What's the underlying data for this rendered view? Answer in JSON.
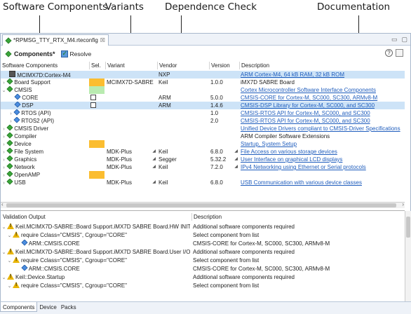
{
  "callouts": {
    "software_components": "Software Components",
    "variants": "Variants",
    "dependence_check": "Dependence Check",
    "documentation": "Documentation"
  },
  "editor": {
    "tab_title": "*RPMSG_TTY_RTX_M4.rteconfig",
    "tab_close": "☒",
    "toolbar_title": "Components*",
    "resolve_label": "Resolve",
    "help_label": "?"
  },
  "components": {
    "headers": {
      "name": "Software Components",
      "sel": "Sel.",
      "variant": "Variant",
      "vendor": "Vendor",
      "version": "Version",
      "description": "Description"
    },
    "rows": [
      {
        "name": "MCIMX7D:Cortex-M4",
        "sel": "",
        "variant": "",
        "vendor": "NXP",
        "version": "",
        "description": "ARM Cortex-M4, 64 kB RAM, 32 kB ROM"
      },
      {
        "name": "Board Support",
        "sel": "",
        "variant": "MCIMX7D-SABRE",
        "vendor": "Keil",
        "version": "1.0.0",
        "description": "iMX7D SABRE Board"
      },
      {
        "name": "CMSIS",
        "sel": "",
        "variant": "",
        "vendor": "",
        "version": "",
        "description": "Cortex Microcontroller Software Interface Components"
      },
      {
        "name": "CORE",
        "sel": "",
        "variant": "",
        "vendor": "ARM",
        "version": "5.0.0",
        "description": "CMSIS-CORE for Cortex-M, SC000, SC300, ARMv8-M"
      },
      {
        "name": "DSP",
        "sel": "",
        "variant": "",
        "vendor": "ARM",
        "version": "1.4.6",
        "description": "CMSIS-DSP Library for Cortex-M, SC000, and SC300"
      },
      {
        "name": "RTOS (API)",
        "sel": "",
        "variant": "",
        "vendor": "",
        "version": "1.0",
        "description": "CMSIS-RTOS API for Cortex-M, SC000, and SC300"
      },
      {
        "name": "RTOS2 (API)",
        "sel": "",
        "variant": "",
        "vendor": "",
        "version": "2.0",
        "description": "CMSIS-RTOS API for Cortex-M, SC000, and SC300"
      },
      {
        "name": "CMSIS Driver",
        "sel": "",
        "variant": "",
        "vendor": "",
        "version": "",
        "description": "Unified Device Drivers compliant to CMSIS-Driver Specifications"
      },
      {
        "name": "Compiler",
        "sel": "",
        "variant": "",
        "vendor": "",
        "version": "",
        "description": "ARM Compiler Software Extensions"
      },
      {
        "name": "Device",
        "sel": "",
        "variant": "",
        "vendor": "",
        "version": "",
        "description": "Startup, System Setup"
      },
      {
        "name": "File System",
        "sel": "",
        "variant": "MDK-Plus",
        "vendor": "Keil",
        "version": "6.8.0",
        "description": "File Access on various storage devices"
      },
      {
        "name": "Graphics",
        "sel": "",
        "variant": "MDK-Plus",
        "vendor": "Segger",
        "version": "5.32.2",
        "description": "User Interface on graphical LCD displays"
      },
      {
        "name": "Network",
        "sel": "",
        "variant": "MDK-Plus",
        "vendor": "Keil",
        "version": "7.2.0",
        "description": "IPv4 Networking using Ethernet or Serial protocols"
      },
      {
        "name": "OpenAMP",
        "sel": "",
        "variant": "",
        "vendor": "",
        "version": "",
        "description": ""
      },
      {
        "name": "USB",
        "sel": "",
        "variant": "MDK-Plus",
        "vendor": "Keil",
        "version": "6.8.0",
        "description": "USB Communication with various device classes"
      }
    ]
  },
  "validation": {
    "headers": {
      "output": "Validation Output",
      "description": "Description"
    },
    "rows": [
      {
        "output": "Keil.MCIMX7D-SABRE::Board Support.iMX7D SABRE Board.HW INIT",
        "description": "Additional software components required"
      },
      {
        "output": "require Cclass=\"CMSIS\", Cgroup=\"CORE\"",
        "description": "Select component from list"
      },
      {
        "output": "ARM::CMSIS.CORE",
        "description": "CMSIS-CORE for Cortex-M, SC000, SC300, ARMv8-M"
      },
      {
        "output": "Keil.MCIMX7D-SABRE::Board Support.iMX7D SABRE Board.User I/O",
        "description": "Additional software components required"
      },
      {
        "output": "require Cclass=\"CMSIS\", Cgroup=\"CORE\"",
        "description": "Select component from list"
      },
      {
        "output": "ARM::CMSIS.CORE",
        "description": "CMSIS-CORE for Cortex-M, SC000, SC300, ARMv8-M"
      },
      {
        "output": "Keil::Device.Startup",
        "description": "Additional software components required"
      },
      {
        "output": "require Cclass=\"CMSIS\", Cgroup=\"CORE\"",
        "description": "Select component from list"
      }
    ]
  },
  "bottom_tabs": [
    "Components",
    "Device",
    "Packs"
  ]
}
